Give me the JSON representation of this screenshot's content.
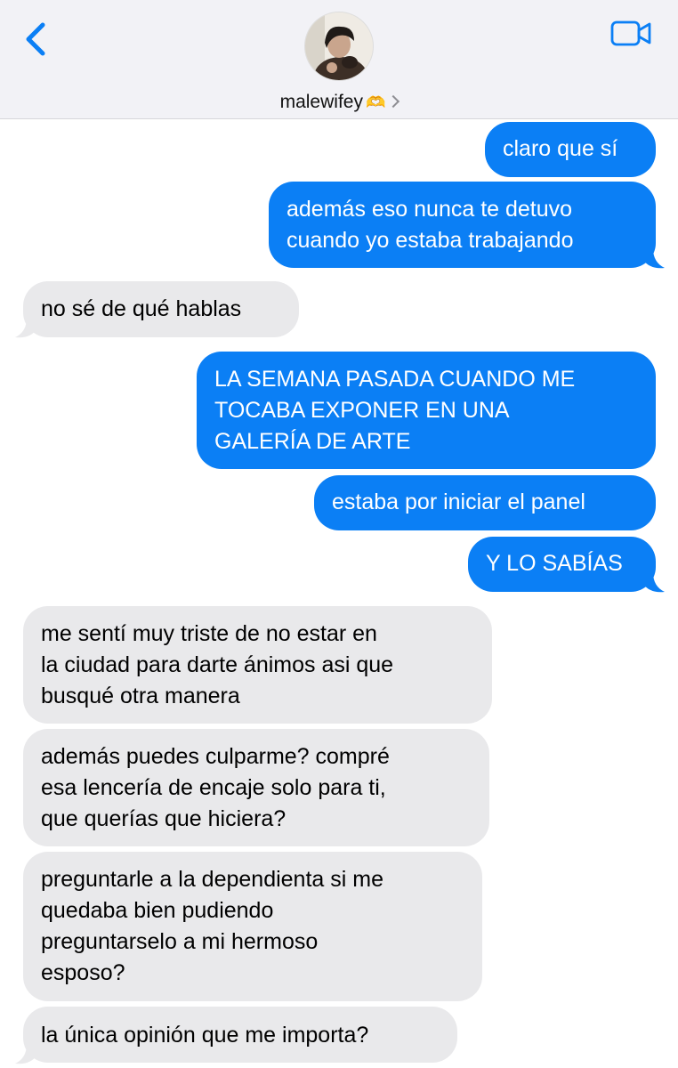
{
  "header": {
    "contact_name": "malewifey",
    "contact_emoji": "🫶",
    "back_icon": "chevron-left-icon",
    "video_icon": "video-camera-icon",
    "accent_color": "#0b7ff5"
  },
  "messages": [
    {
      "direction": "outgoing",
      "lines": [
        "claro que sí"
      ]
    },
    {
      "direction": "outgoing",
      "lines": [
        "además eso nunca te detuvo",
        "cuando yo estaba trabajando"
      ]
    },
    {
      "direction": "incoming",
      "lines": [
        "no sé de qué hablas"
      ]
    },
    {
      "direction": "outgoing",
      "lines": [
        "LA SEMANA PASADA CUANDO ME",
        "TOCABA EXPONER EN UNA",
        "GALERÍA DE ARTE"
      ]
    },
    {
      "direction": "outgoing",
      "lines": [
        "estaba por iniciar el panel"
      ]
    },
    {
      "direction": "outgoing",
      "lines": [
        "Y LO SABÍAS"
      ]
    },
    {
      "direction": "incoming",
      "lines": [
        "me sentí muy triste de no estar en",
        "la ciudad para darte ánimos asi que",
        "busqué otra manera"
      ]
    },
    {
      "direction": "incoming",
      "lines": [
        "además puedes culparme? compré",
        "esa lencería de encaje solo para ti,",
        "que querías que hiciera?"
      ]
    },
    {
      "direction": "incoming",
      "lines": [
        "preguntarle a la dependienta si me",
        "quedaba bien pudiendo",
        "preguntarselo a mi hermoso",
        "esposo?"
      ]
    },
    {
      "direction": "incoming",
      "lines": [
        "la única opinión que me importa?"
      ]
    }
  ]
}
